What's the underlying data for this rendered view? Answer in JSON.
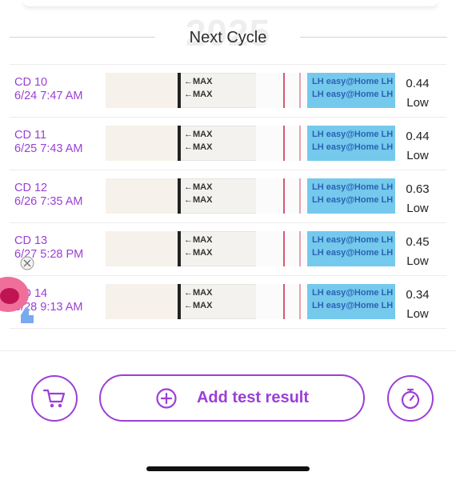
{
  "header": {
    "watermark_year": "2025",
    "section_title": "Next Cycle"
  },
  "strip_text": {
    "max_label": "MAX",
    "wrap_text": "LH easy@Home LH"
  },
  "tests": [
    {
      "cycle_day": "CD 10",
      "datetime": "6/24 7:47 AM",
      "value": "0.44",
      "level": "Low"
    },
    {
      "cycle_day": "CD 11",
      "datetime": "6/25 7:43 AM",
      "value": "0.44",
      "level": "Low"
    },
    {
      "cycle_day": "CD 12",
      "datetime": "6/26 7:35 AM",
      "value": "0.63",
      "level": "Low"
    },
    {
      "cycle_day": "CD 13",
      "datetime": "6/27 5:28 PM",
      "value": "0.45",
      "level": "Low"
    },
    {
      "cycle_day": "CD 14",
      "datetime": "6/28 9:13 AM",
      "value": "0.34",
      "level": "Low"
    }
  ],
  "actions": {
    "add_label": "Add test result",
    "cart_icon": "cart-icon",
    "plus_icon": "plus-circle-icon",
    "timer_icon": "stopwatch-icon"
  },
  "colors": {
    "accent": "#9b3fd6",
    "strip_wrap": "#74c9ec",
    "test_band": "#d65a72"
  }
}
